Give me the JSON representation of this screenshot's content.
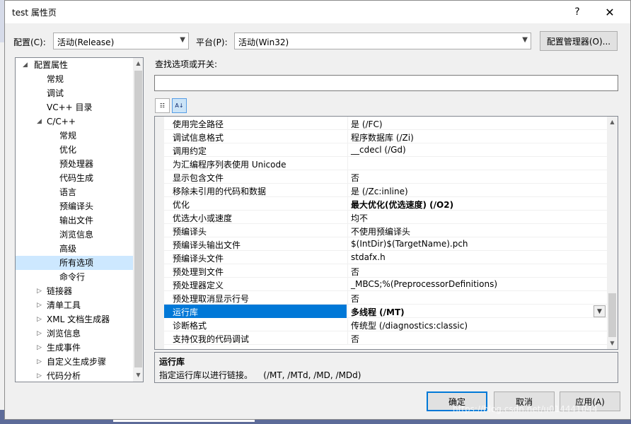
{
  "window": {
    "title": "test 属性页",
    "help": "?",
    "close": "✕"
  },
  "config": {
    "config_label": "配置(C):",
    "config_value": "活动(Release)",
    "platform_label": "平台(P):",
    "platform_value": "活动(Win32)",
    "manager_button": "配置管理器(O)..."
  },
  "tree": {
    "items": [
      {
        "label": "配置属性",
        "expander": "◢"
      },
      {
        "label": "常规"
      },
      {
        "label": "调试"
      },
      {
        "label": "VC++ 目录"
      },
      {
        "label": "C/C++",
        "expander": "◢"
      },
      {
        "label": "常规"
      },
      {
        "label": "优化"
      },
      {
        "label": "预处理器"
      },
      {
        "label": "代码生成"
      },
      {
        "label": "语言"
      },
      {
        "label": "预编译头"
      },
      {
        "label": "输出文件"
      },
      {
        "label": "浏览信息"
      },
      {
        "label": "高级"
      },
      {
        "label": "所有选项"
      },
      {
        "label": "命令行"
      },
      {
        "label": "链接器",
        "expander": "▷"
      },
      {
        "label": "清单工具",
        "expander": "▷"
      },
      {
        "label": "XML 文档生成器",
        "expander": "▷"
      },
      {
        "label": "浏览信息",
        "expander": "▷"
      },
      {
        "label": "生成事件",
        "expander": "▷"
      },
      {
        "label": "自定义生成步骤",
        "expander": "▷"
      },
      {
        "label": "代码分析",
        "expander": "▷"
      }
    ]
  },
  "search": {
    "label": "查找选项或开关:",
    "value": ""
  },
  "toolbar": {
    "categorized": "☷",
    "alphabetical": "A↓"
  },
  "grid": {
    "rows": [
      {
        "name": "使用完全路径",
        "value": "是 (/FC)"
      },
      {
        "name": "调试信息格式",
        "value": "程序数据库 (/Zi)"
      },
      {
        "name": "调用约定",
        "value": "__cdecl (/Gd)"
      },
      {
        "name": "为汇编程序列表使用 Unicode",
        "value": ""
      },
      {
        "name": "显示包含文件",
        "value": "否"
      },
      {
        "name": "移除未引用的代码和数据",
        "value": "是 (/Zc:inline)"
      },
      {
        "name": "优化",
        "value": "最大优化(优选速度) (/O2)"
      },
      {
        "name": "优选大小或速度",
        "value": "均不"
      },
      {
        "name": "预编译头",
        "value": "不使用预编译头"
      },
      {
        "name": "预编译头输出文件",
        "value": "$(IntDir)$(TargetName).pch"
      },
      {
        "name": "预编译头文件",
        "value": "stdafx.h"
      },
      {
        "name": "预处理到文件",
        "value": "否"
      },
      {
        "name": "预处理器定义",
        "value": "_MBCS;%(PreprocessorDefinitions)"
      },
      {
        "name": "预处理取消显示行号",
        "value": "否"
      },
      {
        "name": "运行库",
        "value": "多线程 (/MT)"
      },
      {
        "name": "诊断格式",
        "value": "传统型 (/diagnostics:classic)"
      },
      {
        "name": "支持仅我的代码调试",
        "value": "否"
      }
    ]
  },
  "description": {
    "title": "运行库",
    "text": "指定运行库以进行链接。    (/MT, /MTd, /MD, /MDd)"
  },
  "buttons": {
    "ok": "确定",
    "cancel": "取消",
    "apply": "应用(A)"
  },
  "watermark": "https://blog.csdn.net/u014441044",
  "colors": {
    "selection": "#0078d7",
    "tree_selection": "#cde8ff",
    "dialog_bg": "#f0f0f0"
  }
}
